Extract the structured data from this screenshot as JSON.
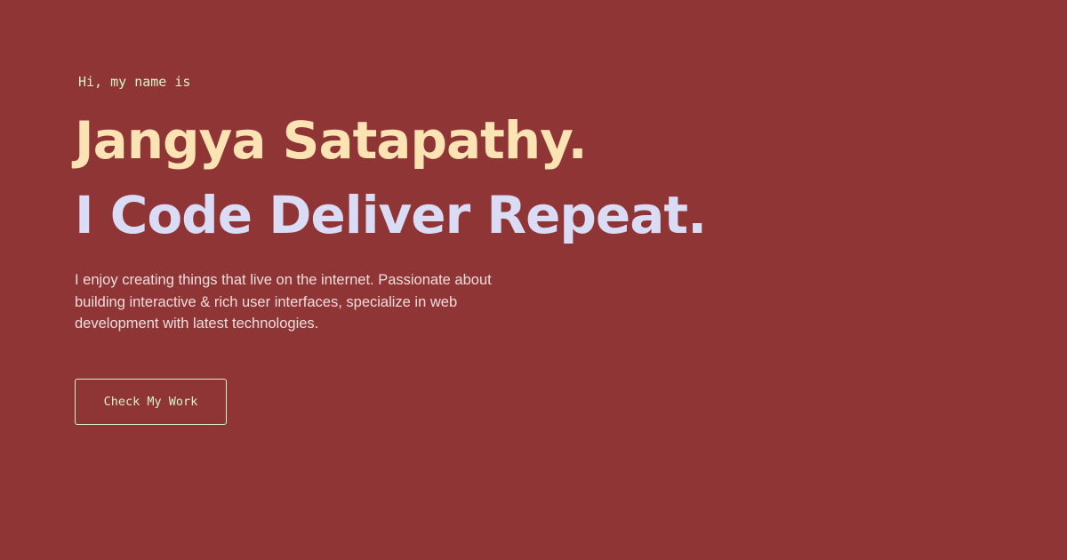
{
  "hero": {
    "greeting": "Hi, my name is",
    "name": "Jangya Satapathy.",
    "tagline": "I Code Deliver Repeat.",
    "intro": "I enjoy creating things that live on the internet. Passionate about building interactive & rich user interfaces, specialize in web development with latest technologies.",
    "cta_label": "Check My Work"
  },
  "colors": {
    "background": "#8f3535",
    "greeting": "#d7f2c6",
    "name": "#fce3b4",
    "tagline": "#d9dcf4",
    "body_text": "#f1dcdc",
    "button_border": "#d7f2c6"
  }
}
